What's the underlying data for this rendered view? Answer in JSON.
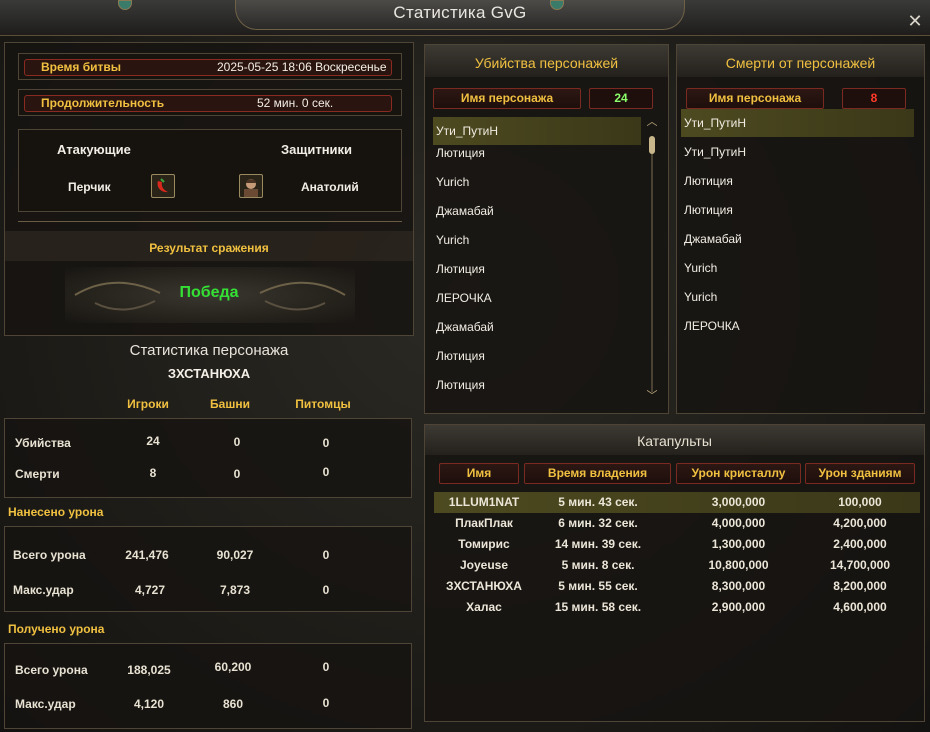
{
  "window": {
    "title": "Статистика GvG",
    "close_glyph": "✕"
  },
  "battle": {
    "time_label": "Время битвы",
    "time_value": "2025-05-25 18:06 Воскресенье",
    "duration_label": "Продолжительность",
    "duration_value": "52 мин. 0 сек.",
    "attackers_label": "Атакующие",
    "defenders_label": "Защитники",
    "attacker_name": "Перчик",
    "attacker_icon": "chili-pepper-icon",
    "defender_name": "Анатолий",
    "defender_icon": "guild-portrait-icon",
    "result_label": "Результат сражения",
    "result_value": "Победа"
  },
  "character": {
    "section_title": "Статистика персонажа",
    "name": "ЗХСТАНЮХА",
    "columns": [
      "Игроки",
      "Башни",
      "Питомцы"
    ],
    "kills": {
      "label": "Убийства",
      "values": [
        "24",
        "0",
        "0"
      ]
    },
    "deaths": {
      "label": "Смерти",
      "values": [
        "8",
        "0",
        "0"
      ]
    },
    "damage_dealt_title": "Нанесено урона",
    "dealt_total": {
      "label": "Всего урона",
      "values": [
        "241,476",
        "90,027",
        "0"
      ]
    },
    "dealt_max": {
      "label": "Макс.удар",
      "values": [
        "4,727",
        "7,873",
        "0"
      ]
    },
    "damage_taken_title": "Получено урона",
    "taken_total": {
      "label": "Всего урона",
      "values": [
        "188,025",
        "60,200",
        "0"
      ]
    },
    "taken_max": {
      "label": "Макс.удар",
      "values": [
        "4,120",
        "860",
        "0"
      ]
    }
  },
  "kills_panel": {
    "title": "Убийства персонажей",
    "name_header": "Имя персонажа",
    "count": "24",
    "rows": [
      "Ути_ПутиН",
      "Лютиция",
      "Yurich",
      "Джамабай",
      "Yurich",
      "Лютиция",
      "ЛЕРОЧКА",
      "Джамабай",
      "Лютиция",
      "Лютиция"
    ]
  },
  "deaths_panel": {
    "title": "Смерти от персонажей",
    "name_header": "Имя персонажа",
    "count": "8",
    "rows": [
      "Ути_ПутиН",
      "Ути_ПутиН",
      "Лютиция",
      "Лютиция",
      "Джамабай",
      "Yurich",
      "Yurich",
      "ЛЕРОЧКА"
    ]
  },
  "catapults": {
    "title": "Катапульты",
    "columns": [
      "Имя",
      "Время владения",
      "Урон кристаллу",
      "Урон зданиям"
    ],
    "rows": [
      [
        "1LLUM1NAT",
        "5 мин. 43 сек.",
        "3,000,000",
        "100,000"
      ],
      [
        "ПлакПлак",
        "6 мин. 32 сек.",
        "4,000,000",
        "4,200,000"
      ],
      [
        "Томирис",
        "14 мин. 39 сек.",
        "1,300,000",
        "2,400,000"
      ],
      [
        "Joyeuse",
        "5 мин. 8 сек.",
        "10,800,000",
        "14,700,000"
      ],
      [
        "ЗХСТАНЮХА",
        "5 мин. 55 сек.",
        "8,300,000",
        "8,200,000"
      ],
      [
        "Халас",
        "15 мин. 58 сек.",
        "2,900,000",
        "4,600,000"
      ]
    ]
  },
  "colors": {
    "accent_gold": "#f0c040",
    "victory_green": "#35e035",
    "kills_count": "#8aff6a",
    "deaths_count": "#ff3a2a",
    "header_border": "#7a2a20"
  }
}
